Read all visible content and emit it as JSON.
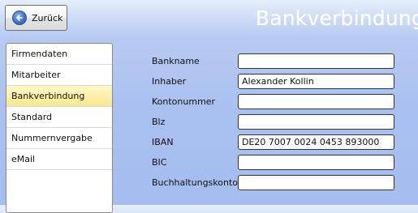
{
  "header": {
    "title": "Bankverbindung",
    "back_label": "Zurück"
  },
  "sidebar": {
    "items": [
      {
        "label": "Firmendaten"
      },
      {
        "label": "Mitarbeiter"
      },
      {
        "label": "Bankverbindung",
        "selected": true
      },
      {
        "label": "Standard"
      },
      {
        "label": "Nummernvergabe"
      },
      {
        "label": "eMail"
      }
    ]
  },
  "form": {
    "fields": [
      {
        "label": "Bankname",
        "value": ""
      },
      {
        "label": "Inhaber",
        "value": "Alexander Kollin"
      },
      {
        "label": "Kontonummer",
        "value": ""
      },
      {
        "label": "Blz",
        "value": ""
      },
      {
        "label": "IBAN",
        "value": "DE20 7007 0024 0453 893000"
      },
      {
        "label": "BIC",
        "value": ""
      },
      {
        "label": "Buchhaltungskonto",
        "value": ""
      }
    ]
  },
  "colors": {
    "selected_item": "#fbe98e",
    "background": "#a9c0ef",
    "back_icon": "#3e74c9"
  },
  "icons": {
    "back": "arrow-left-circle-icon"
  }
}
